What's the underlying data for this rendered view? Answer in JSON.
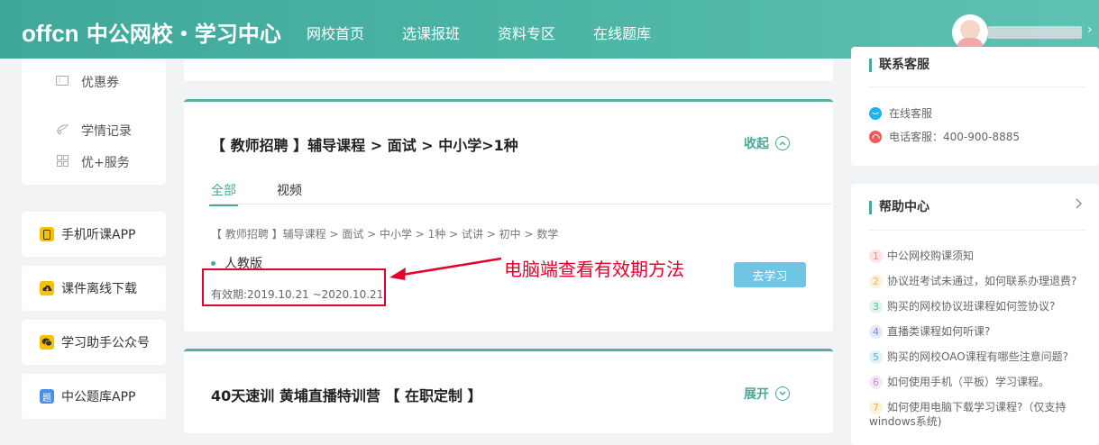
{
  "header": {
    "logo_en": "offcn",
    "logo_cn": "中公网校・学习中心",
    "nav": [
      "网校首页",
      "选课报班",
      "资料专区",
      "在线题库"
    ]
  },
  "sidebar": {
    "menu": [
      {
        "label": "优惠券",
        "icon": "ticket-icon"
      },
      {
        "label": "学情记录",
        "icon": "record-icon"
      },
      {
        "label": "优+服务",
        "icon": "grid-icon"
      }
    ],
    "apps": [
      {
        "label": "手机听课APP",
        "icon": "phone-icon",
        "color": "#f7c100"
      },
      {
        "label": "课件离线下载",
        "icon": "download-icon",
        "color": "#f7c100"
      },
      {
        "label": "学习助手公众号",
        "icon": "wechat-icon",
        "color": "#f7c100"
      },
      {
        "label": "中公题库APP",
        "icon": "question-bank-icon",
        "color": "#4b8ee8"
      }
    ]
  },
  "course1": {
    "title": "【 教师招聘 】辅导课程 > 面试 > 中小学>1种",
    "toggle": "收起",
    "tabs": [
      "全部",
      "视频"
    ],
    "breadcrumb": "【 教师招聘 】辅导课程 > 面试 > 中小学 > 1种 > 试讲 > 初中 > 数学",
    "version": "人教版",
    "validity": "有效期:2019.10.21 ~2020.10.21",
    "go_button": "去学习",
    "annotation": "电脑端查看有效期方法"
  },
  "course2": {
    "title": "40天速训 黄埔直播特训营 【 在职定制 】",
    "toggle": "展开"
  },
  "contact": {
    "title": "联系客服",
    "online": "在线客服",
    "phone": "电话客服：400-900-8885"
  },
  "help": {
    "title": "帮助中心",
    "items": [
      {
        "num": "1",
        "text": "中公网校购课须知",
        "color": "#f08a8a"
      },
      {
        "num": "2",
        "text": "协议班考试未通过，如何联系办理退费?",
        "color": "#f3b24d"
      },
      {
        "num": "3",
        "text": "购买的网校协议班课程如何签协议?",
        "color": "#4ec5a3"
      },
      {
        "num": "4",
        "text": "直播类课程如何听课?",
        "color": "#7b8ee8"
      },
      {
        "num": "5",
        "text": "购买的网校OAO课程有哪些注意问题?",
        "color": "#5ab2e6"
      },
      {
        "num": "6",
        "text": "如何使用手机（平板）学习课程。",
        "color": "#d48be0"
      },
      {
        "num": "7",
        "text": "如何使用电脑下载学习课程?（仅支持windows系统)",
        "color": "#f3b24d"
      }
    ]
  },
  "colors": {
    "accent": "#4aa89a",
    "annotation": "#e4002b",
    "button": "#6ec5e4"
  }
}
